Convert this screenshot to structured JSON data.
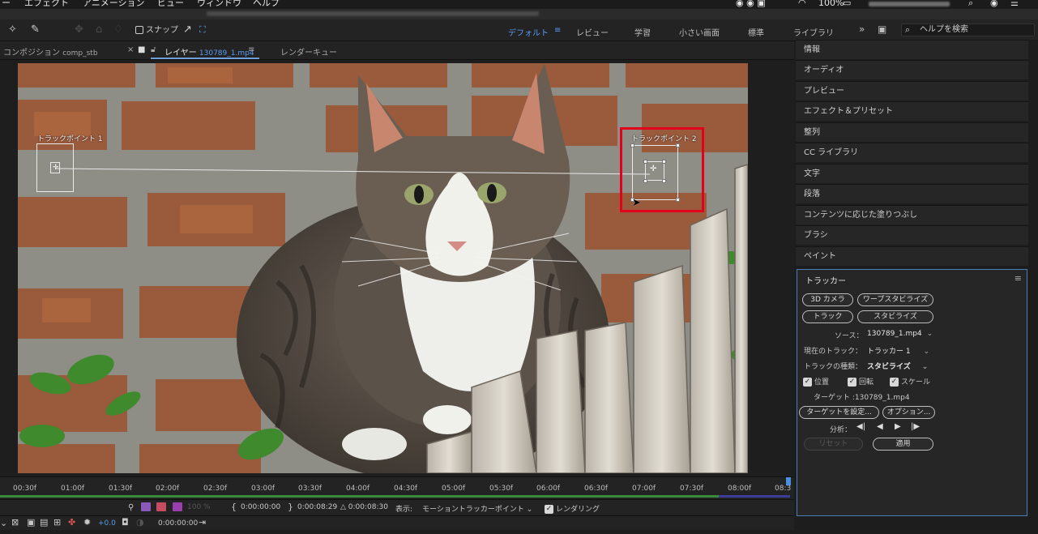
{
  "menubar": {
    "items": [
      "ー",
      "エフェクト",
      "アニメーション",
      "ビュー",
      "ウィンドウ",
      "ヘルプ"
    ],
    "battery": "100%"
  },
  "toolbar": {
    "snap_label": "スナップ",
    "workspaces": [
      "デフォルト",
      "レビュー",
      "学習",
      "小さい画面",
      "標準",
      "ライブラリ"
    ],
    "active_workspace": "デフォルト",
    "more": "»",
    "search_placeholder": "ヘルプを検索"
  },
  "tabs": {
    "composition": {
      "label": "コンポジション",
      "name": "comp_stb"
    },
    "layer": {
      "label": "レイヤー",
      "name": "130789_1.mp4"
    },
    "render_queue": {
      "label": "レンダーキュー"
    }
  },
  "viewer": {
    "track_point_1": "トラックポイント 1",
    "track_point_2": "トラックポイント 2"
  },
  "timeline": {
    "ticks": [
      "00:30f",
      "01:00f",
      "01:30f",
      "02:00f",
      "02:30f",
      "03:00f",
      "03:30f",
      "04:00f",
      "04:30f",
      "05:00f",
      "05:30f",
      "06:00f",
      "06:30f",
      "07:00f",
      "07:30f",
      "08:00f",
      "08:3"
    ]
  },
  "controls": {
    "zoom": "100 %",
    "in_point": "0:00:00:00",
    "out_point": "0:00:08:29",
    "duration": "△ 0:00:08:30",
    "view_label": "表示:",
    "view_value": "モーショントラッカーポイント",
    "render_label": "レンダリング",
    "exposure": "+0.0",
    "current_time": "0:00:00:00"
  },
  "right_panel": {
    "sections": [
      "情報",
      "オーディオ",
      "プレビュー",
      "エフェクト＆プリセット",
      "整列",
      "CC ライブラリ",
      "文字",
      "段落",
      "コンテンツに応じた塗りつぶし",
      "ブラシ",
      "ペイント"
    ]
  },
  "tracker": {
    "title": "トラッカー",
    "btn_3d_camera": "3D カメラ",
    "btn_warp": "ワープスタビライズ",
    "btn_track": "トラック",
    "btn_stabilize": "スタビライズ",
    "source_label": "ソース：",
    "source_value": "130789_1.mp4",
    "current_track_label": "現在のトラック：",
    "current_track_value": "トラッカー 1",
    "track_type_label": "トラックの種類：",
    "track_type_value": "スタビライズ",
    "position": "位置",
    "rotation": "回転",
    "scale": "スケール",
    "target": "ターゲット :130789_1.mp4",
    "btn_set_target": "ターゲットを設定...",
    "btn_options": "オプション...",
    "analyze_label": "分析：",
    "btn_reset": "リセット",
    "btn_apply": "適用"
  }
}
